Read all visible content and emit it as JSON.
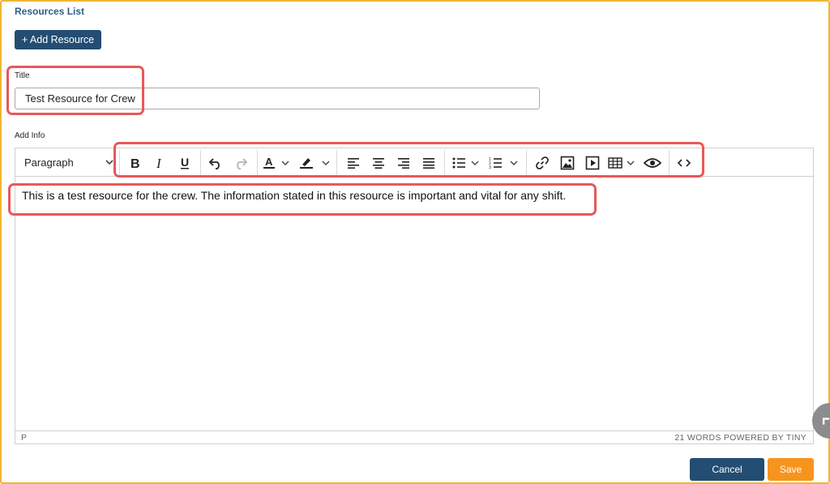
{
  "breadcrumb": "Resources List",
  "add_resource_label": "+ Add Resource",
  "title_field": {
    "label": "Title",
    "value": "Test Resource for Crew"
  },
  "info_field": {
    "label": "Add Info"
  },
  "editor": {
    "block_format": "Paragraph",
    "toolbar_icons": [
      "bold-icon",
      "italic-icon",
      "underline-icon",
      "undo-icon",
      "redo-icon",
      "text-color-icon",
      "highlight-color-icon",
      "align-left-icon",
      "align-center-icon",
      "align-right-icon",
      "align-justify-icon",
      "bullet-list-icon",
      "numbered-list-icon",
      "link-icon",
      "image-icon",
      "media-icon",
      "table-icon",
      "preview-icon",
      "source-code-icon"
    ],
    "content": "This is a test resource for the crew. The information stated in this resource is important and vital for any shift.",
    "status_path": "P",
    "status_info": "21 WORDS  POWERED BY TINY"
  },
  "actions": {
    "cancel_label": "Cancel",
    "save_label": "Save"
  },
  "colors": {
    "accent_blue": "#234d73",
    "save_orange": "#f7941d",
    "highlight_red": "#e8585a",
    "frame_gold": "#f0b72f"
  }
}
